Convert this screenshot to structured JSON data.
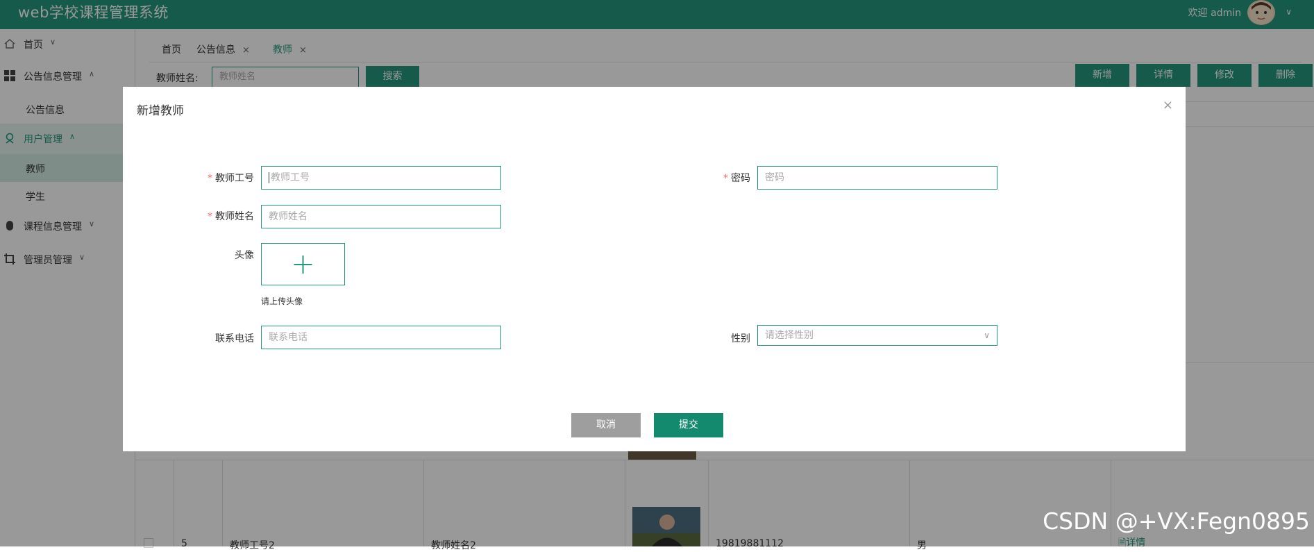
{
  "app": {
    "title": "web学校课程管理系统",
    "welcome": "欢迎 admin"
  },
  "sidebar": {
    "home": "首页",
    "notice_mgmt": "公告信息管理",
    "notice": "公告信息",
    "user_mgmt": "用户管理",
    "teacher": "教师",
    "student": "学生",
    "course_mgmt": "课程信息管理",
    "admin_mgmt": "管理员管理"
  },
  "tabs": [
    {
      "label": "首页"
    },
    {
      "label": "公告信息"
    },
    {
      "label": "教师"
    }
  ],
  "toolbar": {
    "search_label": "教师姓名:",
    "search_placeholder": "教师姓名",
    "search_button": "搜索",
    "add_button": "新增",
    "detail_button": "详情",
    "edit_button": "修改",
    "delete_button": "删除"
  },
  "table_row": {
    "index": "5",
    "teacher_no": "教师工号2",
    "teacher_name": "教师姓名2",
    "phone": "19819881112",
    "gender": "男",
    "action": "详情"
  },
  "modal": {
    "title": "新增教师",
    "close": "×",
    "fields": {
      "teacher_no_label": "教师工号",
      "teacher_no_placeholder": "教师工号",
      "password_label": "密码",
      "password_placeholder": "密码",
      "teacher_name_label": "教师姓名",
      "teacher_name_placeholder": "教师姓名",
      "avatar_label": "头像",
      "avatar_tip": "请上传头像",
      "phone_label": "联系电话",
      "phone_placeholder": "联系电话",
      "gender_label": "性别",
      "gender_placeholder": "请选择性别"
    },
    "cancel_button": "取消",
    "submit_button": "提交"
  },
  "watermark": "CSDN @+VX:Fegn0895",
  "colors": {
    "primary": "#23967c",
    "cancel": "#9e9e9e",
    "required": "#f56c6c"
  }
}
